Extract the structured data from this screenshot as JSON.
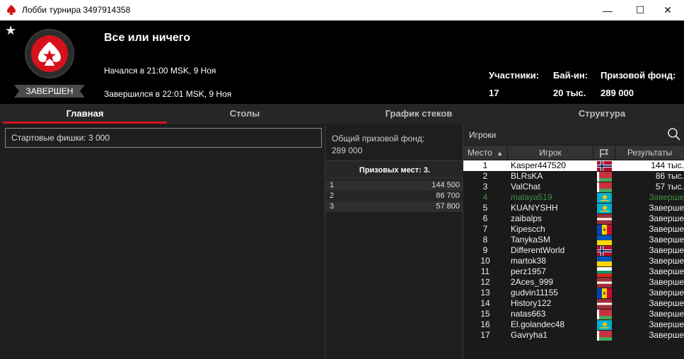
{
  "window": {
    "title": "Лобби турнира 3497914358",
    "min_glyph": "—",
    "max_glyph": "☐",
    "close_glyph": "✕"
  },
  "header": {
    "tournament_name": "Все или ничего",
    "started": "Начался в 21:00 MSK, 9 Ноя",
    "ended": "Завершился в 22:01 MSK, 9 Ноя",
    "status": "ЗАВЕРШЕН",
    "favorite_icon": "star-icon",
    "stats": {
      "players_label": "Участники:",
      "players_value": "17",
      "buyin_label": "Бай-ин:",
      "buyin_value": "20 тыс.",
      "prize_label": "Призовой фонд:",
      "prize_value": "289 000"
    }
  },
  "tabs": [
    "Главная",
    "Столы",
    "График стеков",
    "Структура"
  ],
  "left": {
    "starting_chips": "Стартовые фишки:  3 000"
  },
  "middle": {
    "pool_label": "Общий призовой фонд:",
    "pool_value": "289 000",
    "places_header": "Призовых мест: 3.",
    "prizes": [
      {
        "place": "1",
        "amount": "144 500"
      },
      {
        "place": "2",
        "amount": "86 700"
      },
      {
        "place": "3",
        "amount": "57 800"
      }
    ]
  },
  "players": {
    "title": "Игроки",
    "columns": {
      "place": "Место",
      "player": "Игрок",
      "results": "Результаты"
    },
    "rows": [
      {
        "place": "1",
        "name": "Kasper447520",
        "flag": "norway",
        "result": "144 тыс."
      },
      {
        "place": "2",
        "name": "BLRsKA",
        "flag": "belarus",
        "result": "86 тыс."
      },
      {
        "place": "3",
        "name": "ValChat",
        "flag": "belarus",
        "result": "57 тыс."
      },
      {
        "place": "4",
        "name": "malaya519",
        "flag": "kazakhstan",
        "result": "Заверше"
      },
      {
        "place": "5",
        "name": "KUANYSHH",
        "flag": "kazakhstan",
        "result": "Заверше"
      },
      {
        "place": "6",
        "name": "zaibalps",
        "flag": "latvia",
        "result": "Заверше"
      },
      {
        "place": "7",
        "name": "Kipescch",
        "flag": "moldova",
        "result": "Заверше"
      },
      {
        "place": "8",
        "name": "TanykaSM",
        "flag": "ukraine",
        "result": "Заверше"
      },
      {
        "place": "9",
        "name": "DifferentWorld",
        "flag": "norway",
        "result": "Заверше"
      },
      {
        "place": "10",
        "name": "martok38",
        "flag": "ukraine",
        "result": "Заверше"
      },
      {
        "place": "11",
        "name": "perz1957",
        "flag": "bulgaria",
        "result": "Заверше"
      },
      {
        "place": "12",
        "name": "2Aces_999",
        "flag": "latvia",
        "result": "Заверше"
      },
      {
        "place": "13",
        "name": "gudvin11155",
        "flag": "moldova",
        "result": "Заверше"
      },
      {
        "place": "14",
        "name": "History122",
        "flag": "latvia",
        "result": "Заверше"
      },
      {
        "place": "15",
        "name": "natas663",
        "flag": "belarus",
        "result": "Заверше"
      },
      {
        "place": "16",
        "name": "El.golandec48",
        "flag": "kazakhstan",
        "result": "Заверше"
      },
      {
        "place": "17",
        "name": "Gavryha1",
        "flag": "belarus",
        "result": "Заверше"
      }
    ]
  },
  "colors": {
    "accent_red": "#d6111c",
    "header_bg": "#000000",
    "eliminated_green": "#3f8f3f"
  }
}
